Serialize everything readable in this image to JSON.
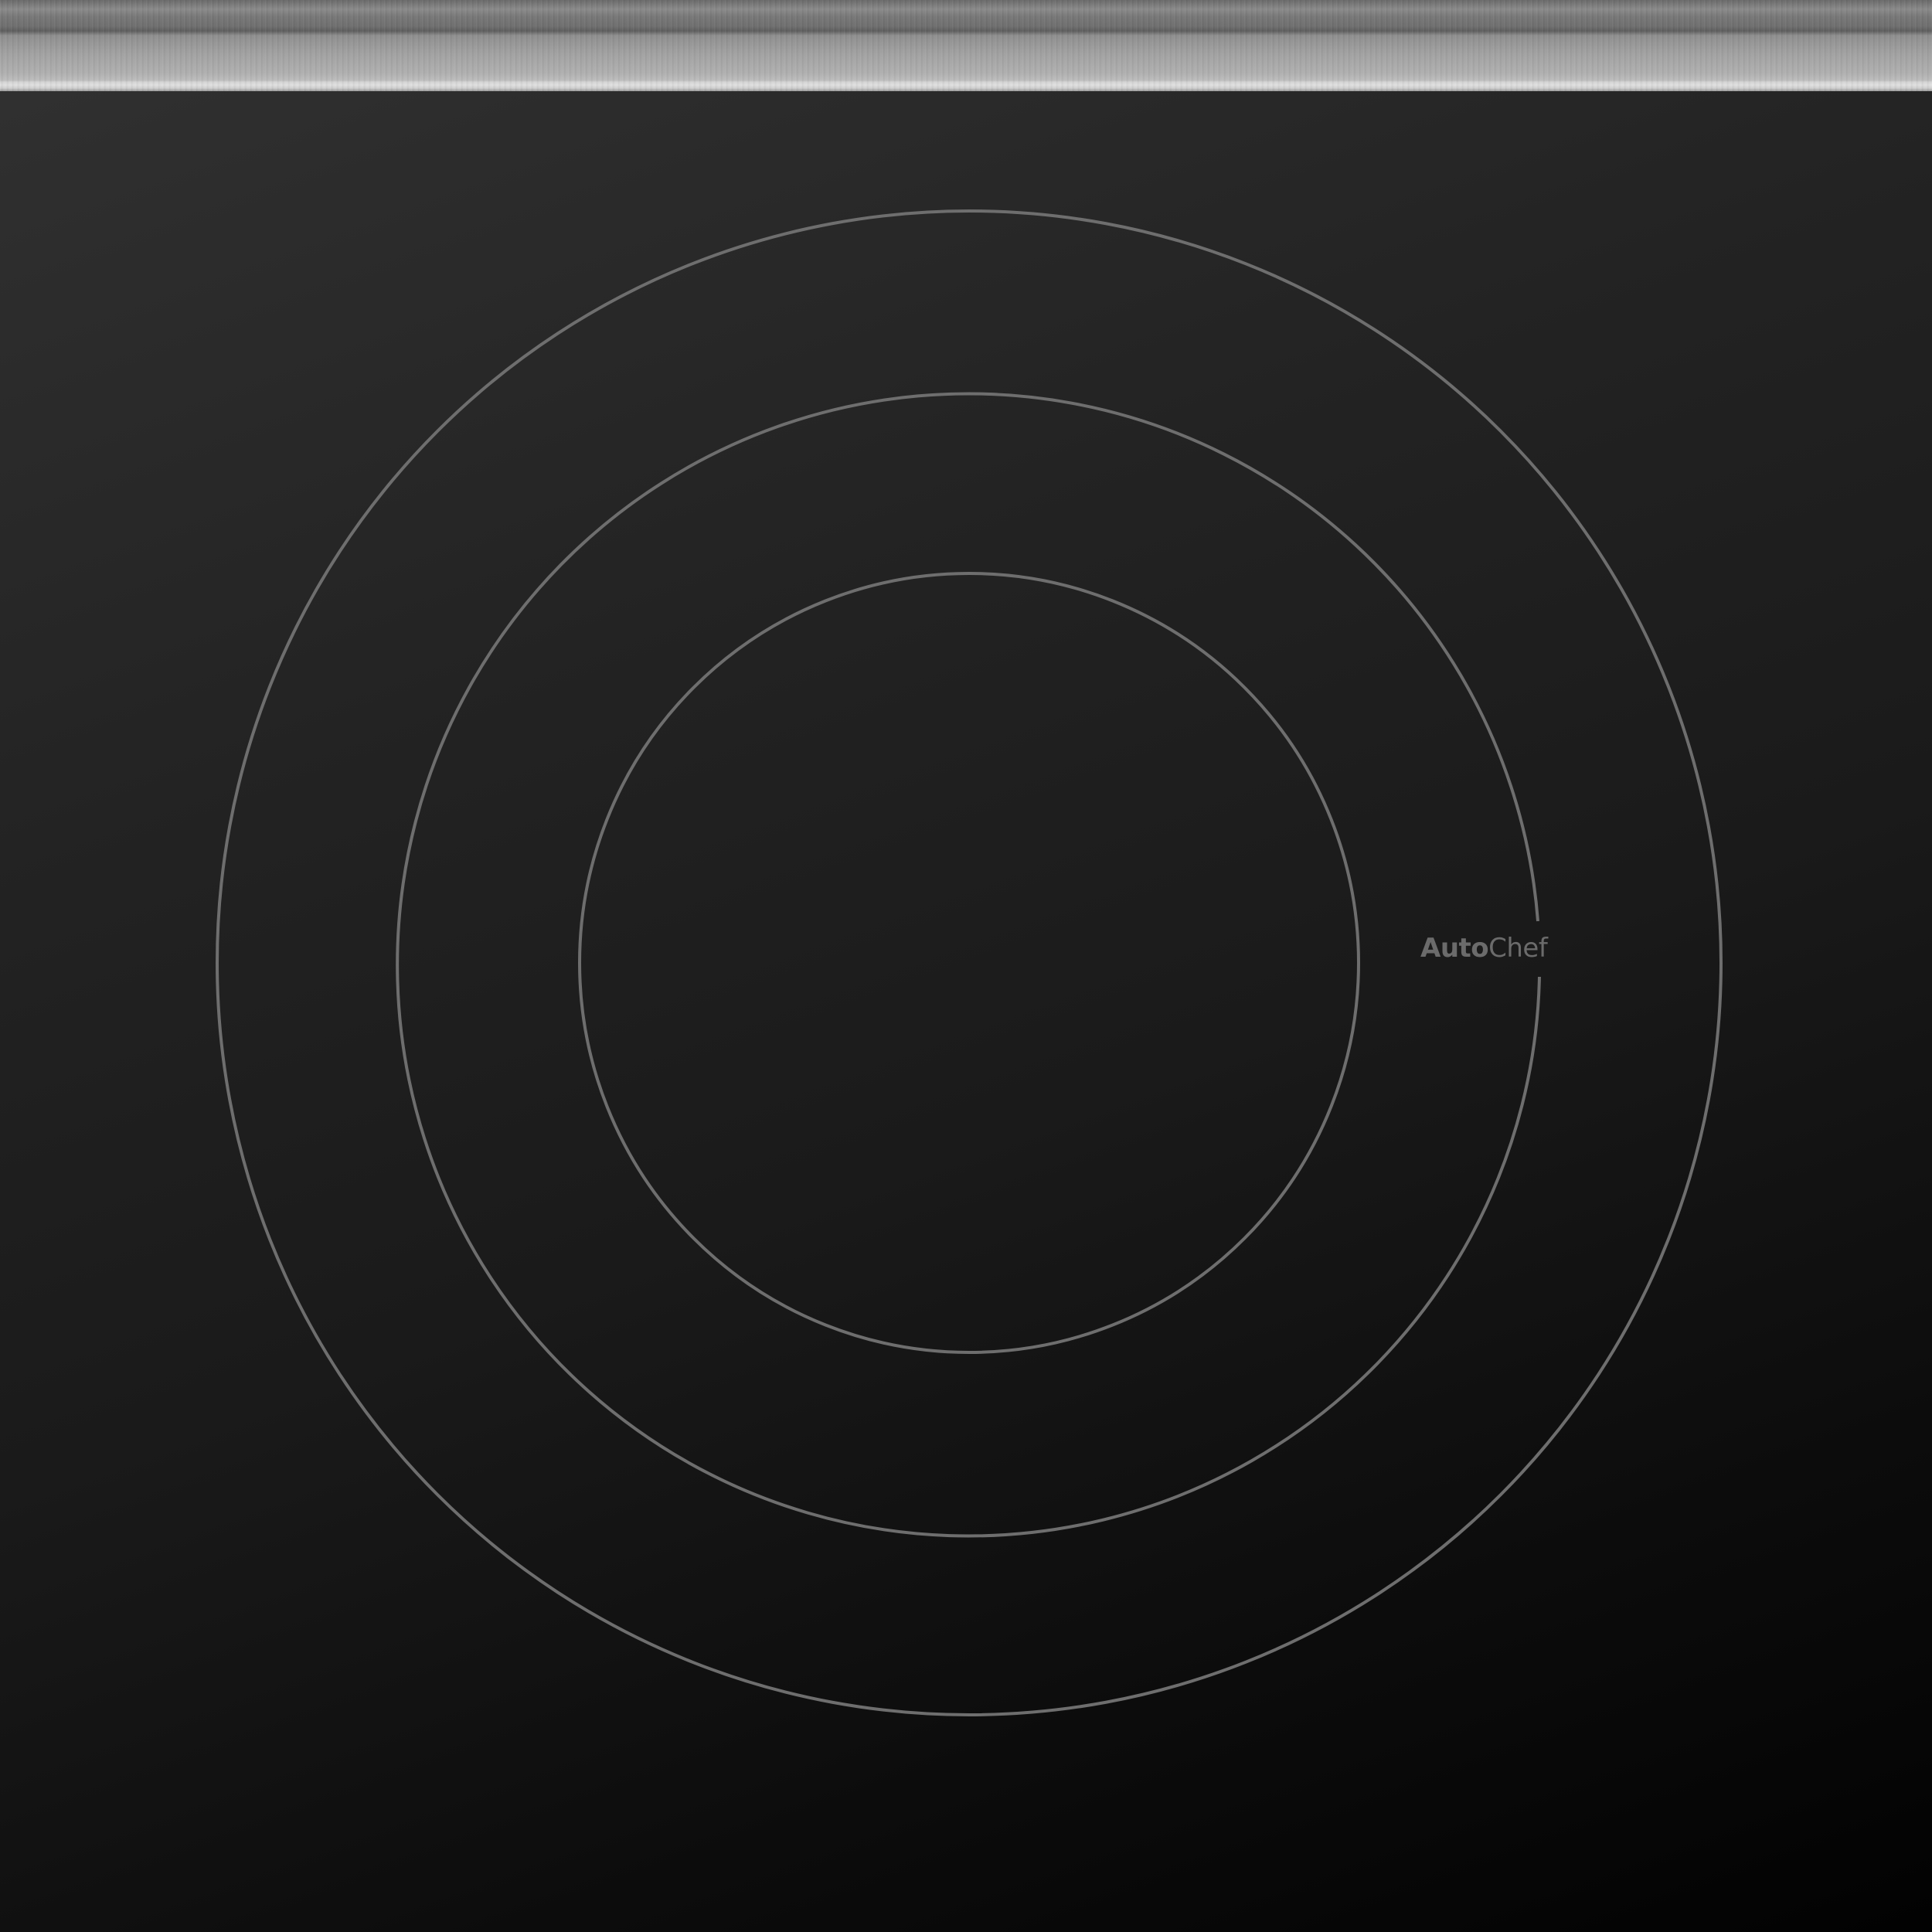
{
  "cooktop": {
    "brand": {
      "part1": "Auto",
      "part2": "Chef"
    },
    "colors": {
      "ring_stroke": "#6e6e6e",
      "brand_text": "#6b6b6b",
      "glass_top": "#303030",
      "glass_bottom": "#020202",
      "trim": "#a2a2a2"
    },
    "burner": {
      "zones": [
        "outer-ring",
        "middle-ring",
        "inner-ring"
      ]
    }
  }
}
